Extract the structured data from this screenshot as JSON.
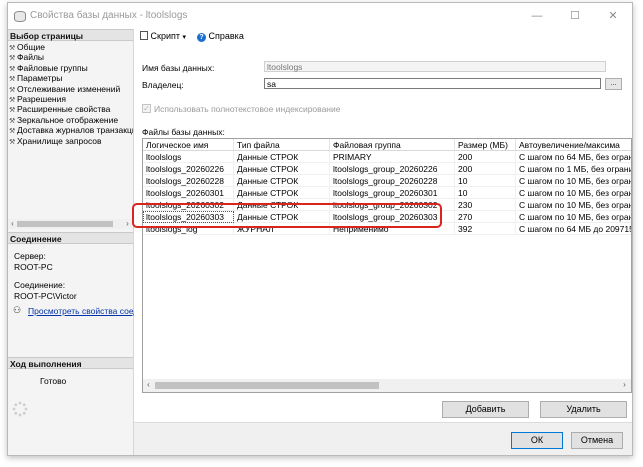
{
  "window": {
    "title": "Свойства базы данных - ltoolslogs",
    "controls": {
      "minimize": "—",
      "maximize": "☐",
      "close": "✕"
    }
  },
  "left_panel": {
    "select_page_header": "Выбор страницы",
    "nav_items": [
      "Общие",
      "Файлы",
      "Файловые группы",
      "Параметры",
      "Отслеживание изменений",
      "Разрешения",
      "Расширенные свойства",
      "Зеркальное отображение",
      "Доставка журналов транзакций",
      "Хранилище запросов"
    ],
    "connection_header": "Соединение",
    "server_label": "Сервер:",
    "server_value": "ROOT-PC",
    "connection_label": "Соединение:",
    "connection_value": "ROOT-PC\\Victor",
    "view_connection_link": "Просмотреть свойства соединения",
    "progress_header": "Ход выполнения",
    "progress_status": "Готово"
  },
  "toolbar": {
    "script_label": "Скрипт",
    "help_label": "Справка"
  },
  "form": {
    "db_name_label": "Имя базы данных:",
    "db_name_value": "ltoolslogs",
    "owner_label": "Владелец:",
    "owner_value": "sa",
    "browse_label": "...",
    "fulltext_label": "Использовать полнотекстовое индексирование",
    "fulltext_checked": true,
    "db_files_label": "Файлы базы данных:"
  },
  "grid": {
    "columns": [
      "Логическое имя",
      "Тип файла",
      "Файловая группа",
      "Размер (МБ)",
      "Автоувеличение/максима"
    ],
    "rows": [
      [
        "ltoolslogs",
        "Данные СТРОК",
        "PRIMARY",
        "200",
        "С шагом по 64 МБ, без ограни"
      ],
      [
        "ltoolslogs_20260226",
        "Данные СТРОК",
        "ltoolslogs_group_20260226",
        "200",
        "С шагом по 1 МБ, без ограни"
      ],
      [
        "ltoolslogs_20260228",
        "Данные СТРОК",
        "ltoolslogs_group_20260228",
        "10",
        "С шагом по 10 МБ, без огран"
      ],
      [
        "ltoolslogs_20260301",
        "Данные СТРОК",
        "ltoolslogs_group_20260301",
        "10",
        "С шагом по 10 МБ, без огран"
      ],
      [
        "ltoolslogs_20260302",
        "Данные СТРОК",
        "ltoolslogs_group_20260302",
        "230",
        "С шагом по 10 МБ, без огран"
      ],
      [
        "ltoolslogs_20260303",
        "Данные СТРОК",
        "ltoolslogs_group_20260303",
        "270",
        "С шагом по 10 МБ, без огран"
      ],
      [
        "ltoolslogs_log",
        "ЖУРНАЛ",
        "Неприменимо",
        "392",
        "С шагом по 64 МБ до 209715"
      ]
    ],
    "selected_row": 5
  },
  "buttons": {
    "add": "Добавить",
    "remove": "Удалить",
    "ok": "ОК",
    "cancel": "Отмена"
  },
  "colors": {
    "highlight": "#d9261c",
    "link": "#0033a8",
    "default_button_border": "#0078d7"
  }
}
